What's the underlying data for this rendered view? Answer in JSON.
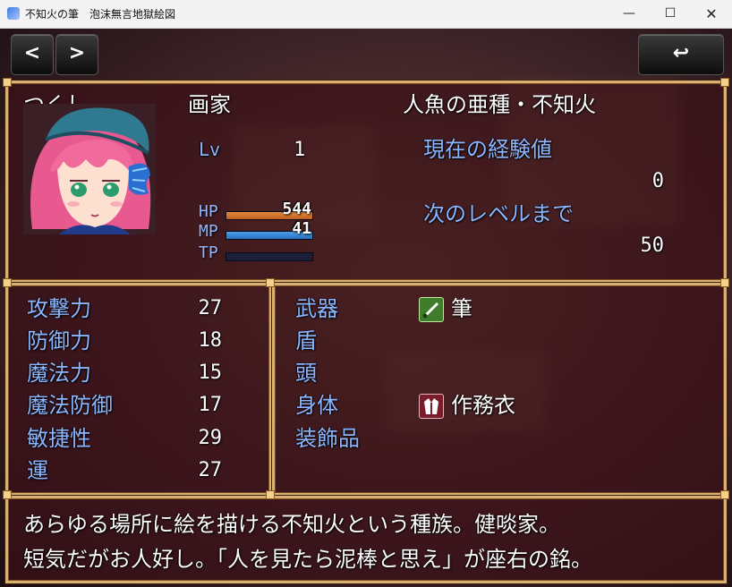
{
  "window": {
    "title": "不知火の筆　泡沫無言地獄絵図",
    "minimize_glyph": "—",
    "maximize_glyph": "☐",
    "close_glyph": "✕"
  },
  "nav": {
    "prev_glyph": "<",
    "next_glyph": ">",
    "back_glyph": "↩"
  },
  "actor": {
    "name": "つくし",
    "class": "画家",
    "nickname": "人魚の亜種・不知火",
    "level_label": "Lv",
    "level": "1",
    "hp_label": "HP",
    "hp": "544",
    "hp_ratio": 1.0,
    "mp_label": "MP",
    "mp": "41",
    "mp_ratio": 1.0,
    "tp_label": "TP",
    "tp_ratio": 0.0,
    "exp_label": "現在の経験値",
    "exp": "0",
    "next_label": "次のレベルまで",
    "next": "50"
  },
  "params": [
    {
      "label": "攻撃力",
      "value": "27"
    },
    {
      "label": "防御力",
      "value": "18"
    },
    {
      "label": "魔法力",
      "value": "15"
    },
    {
      "label": "魔法防御",
      "value": "17"
    },
    {
      "label": "敏捷性",
      "value": "29"
    },
    {
      "label": "運",
      "value": "27"
    }
  ],
  "equips": [
    {
      "slot": "武器",
      "item": "筆",
      "icon": "brush-icon"
    },
    {
      "slot": "盾",
      "item": "",
      "icon": ""
    },
    {
      "slot": "頭",
      "item": "",
      "icon": ""
    },
    {
      "slot": "身体",
      "item": "作務衣",
      "icon": "robe-icon"
    },
    {
      "slot": "装飾品",
      "item": "",
      "icon": ""
    }
  ],
  "profile": {
    "line1": "あらゆる場所に絵を描ける不知火という種族。健啖家。",
    "line2": "短気だがお人好し。「人を見たら泥棒と思え」が座右の銘。"
  },
  "colors": {
    "frame": "#d9b070",
    "system_label": "#8cb6ff",
    "hp_gauge": "#e08a3a",
    "mp_gauge": "#4aa0e8",
    "tp_gauge": "#2a2f5a"
  }
}
